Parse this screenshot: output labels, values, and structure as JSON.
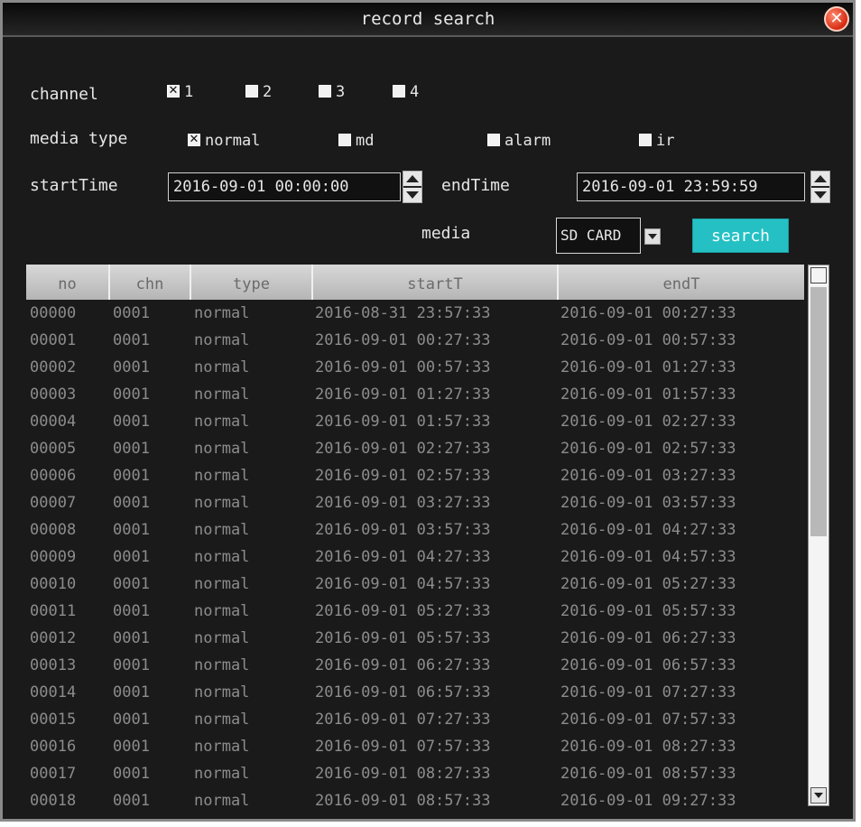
{
  "window": {
    "title": "record search"
  },
  "filters": {
    "channel": {
      "label": "channel",
      "options": [
        {
          "label": "1",
          "checked": true
        },
        {
          "label": "2",
          "checked": false
        },
        {
          "label": "3",
          "checked": false
        },
        {
          "label": "4",
          "checked": false
        }
      ]
    },
    "media_type": {
      "label": "media type",
      "options": [
        {
          "label": "normal",
          "checked": true
        },
        {
          "label": "md",
          "checked": false
        },
        {
          "label": "alarm",
          "checked": false
        },
        {
          "label": "ir",
          "checked": false
        }
      ]
    },
    "start_time": {
      "label": "startTime",
      "value": "2016-09-01 00:00:00"
    },
    "end_time": {
      "label": "endTime",
      "value": "2016-09-01 23:59:59"
    },
    "media": {
      "label": "media",
      "value": "SD CARD"
    },
    "search_label": "search"
  },
  "table": {
    "headers": [
      "no",
      "chn",
      "type",
      "startT",
      "endT"
    ],
    "rows": [
      [
        "00000",
        "0001",
        "normal",
        "2016-08-31 23:57:33",
        "2016-09-01 00:27:33"
      ],
      [
        "00001",
        "0001",
        "normal",
        "2016-09-01 00:27:33",
        "2016-09-01 00:57:33"
      ],
      [
        "00002",
        "0001",
        "normal",
        "2016-09-01 00:57:33",
        "2016-09-01 01:27:33"
      ],
      [
        "00003",
        "0001",
        "normal",
        "2016-09-01 01:27:33",
        "2016-09-01 01:57:33"
      ],
      [
        "00004",
        "0001",
        "normal",
        "2016-09-01 01:57:33",
        "2016-09-01 02:27:33"
      ],
      [
        "00005",
        "0001",
        "normal",
        "2016-09-01 02:27:33",
        "2016-09-01 02:57:33"
      ],
      [
        "00006",
        "0001",
        "normal",
        "2016-09-01 02:57:33",
        "2016-09-01 03:27:33"
      ],
      [
        "00007",
        "0001",
        "normal",
        "2016-09-01 03:27:33",
        "2016-09-01 03:57:33"
      ],
      [
        "00008",
        "0001",
        "normal",
        "2016-09-01 03:57:33",
        "2016-09-01 04:27:33"
      ],
      [
        "00009",
        "0001",
        "normal",
        "2016-09-01 04:27:33",
        "2016-09-01 04:57:33"
      ],
      [
        "00010",
        "0001",
        "normal",
        "2016-09-01 04:57:33",
        "2016-09-01 05:27:33"
      ],
      [
        "00011",
        "0001",
        "normal",
        "2016-09-01 05:27:33",
        "2016-09-01 05:57:33"
      ],
      [
        "00012",
        "0001",
        "normal",
        "2016-09-01 05:57:33",
        "2016-09-01 06:27:33"
      ],
      [
        "00013",
        "0001",
        "normal",
        "2016-09-01 06:27:33",
        "2016-09-01 06:57:33"
      ],
      [
        "00014",
        "0001",
        "normal",
        "2016-09-01 06:57:33",
        "2016-09-01 07:27:33"
      ],
      [
        "00015",
        "0001",
        "normal",
        "2016-09-01 07:27:33",
        "2016-09-01 07:57:33"
      ],
      [
        "00016",
        "0001",
        "normal",
        "2016-09-01 07:57:33",
        "2016-09-01 08:27:33"
      ],
      [
        "00017",
        "0001",
        "normal",
        "2016-09-01 08:27:33",
        "2016-09-01 08:57:33"
      ],
      [
        "00018",
        "0001",
        "normal",
        "2016-09-01 08:57:33",
        "2016-09-01 09:27:33"
      ]
    ]
  },
  "colors": {
    "accent": "#25c0c4",
    "background": "#1a1a1a",
    "row_text": "#8c8c8c",
    "close": "#d62a10"
  },
  "icons": {
    "close": "close-icon",
    "spin_up": "arrow-up-icon",
    "spin_down": "arrow-down-icon",
    "dropdown": "chevron-down-icon"
  }
}
